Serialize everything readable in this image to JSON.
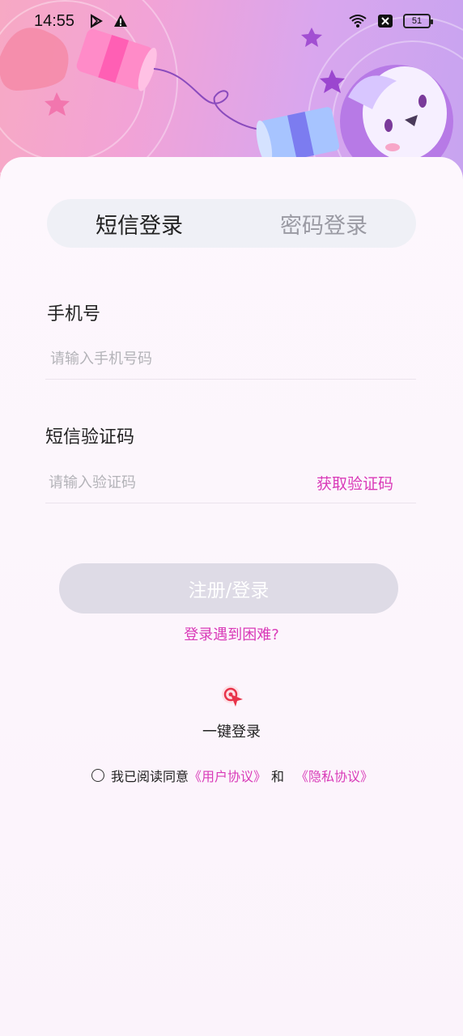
{
  "status_bar": {
    "time": "14:55",
    "icons_left": [
      "play-store-icon",
      "warning-icon"
    ],
    "icons_right": [
      "wifi-icon",
      "close-box-icon"
    ],
    "battery": "51"
  },
  "tabs": [
    {
      "label": "短信登录",
      "active": true
    },
    {
      "label": "密码登录",
      "active": false
    }
  ],
  "phone": {
    "label": "手机号",
    "placeholder": "请输入手机号码",
    "value": ""
  },
  "code": {
    "label": "短信验证码",
    "placeholder": "请输入验证码",
    "value": "",
    "get_code": "获取验证码"
  },
  "submit": "注册/登录",
  "trouble": "登录遇到困难?",
  "one_key_login": "一键登录",
  "agreement": {
    "prefix": "我已阅读同意",
    "user_agreement": "《用户协议》",
    "and": "和",
    "privacy_policy": "《隐私协议》"
  },
  "colors": {
    "accent": "#d93ab8",
    "button_disabled": "#dedbe6",
    "tab_bg": "#eff0f6"
  }
}
